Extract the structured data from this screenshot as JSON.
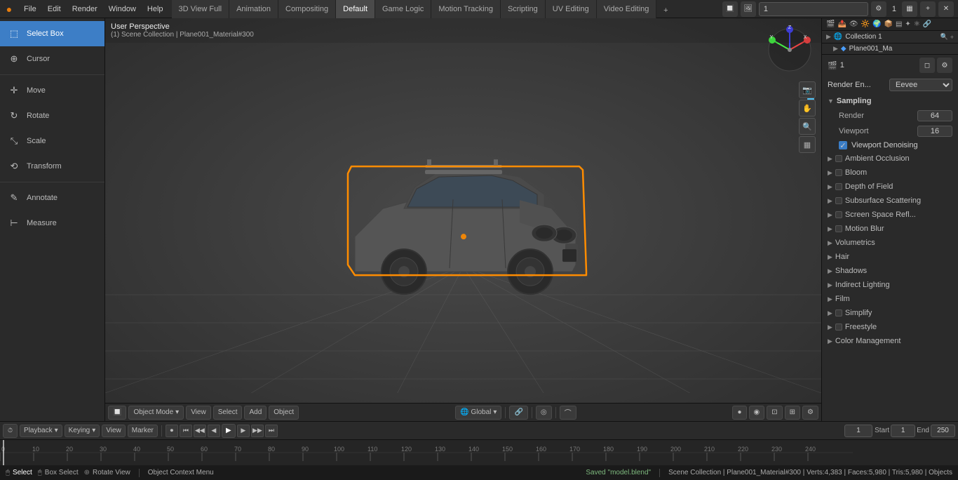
{
  "app": {
    "title": "Blender"
  },
  "menu": {
    "items": [
      "File",
      "Edit",
      "Render",
      "Window",
      "Help"
    ]
  },
  "workspace_tabs": [
    {
      "label": "3D View Full",
      "active": false
    },
    {
      "label": "Animation",
      "active": false
    },
    {
      "label": "Compositing",
      "active": false
    },
    {
      "label": "Default",
      "active": true
    },
    {
      "label": "Game Logic",
      "active": false
    },
    {
      "label": "Motion Tracking",
      "active": false
    },
    {
      "label": "Scripting",
      "active": false
    },
    {
      "label": "UV Editing",
      "active": false
    },
    {
      "label": "Video Editing",
      "active": false
    }
  ],
  "viewport": {
    "perspective": "User Perspective",
    "breadcrumb": "(1) Scene Collection | Plane001_Material#300"
  },
  "tools": [
    {
      "id": "select-box",
      "label": "Select Box",
      "icon": "⬚",
      "active": true
    },
    {
      "id": "cursor",
      "label": "Cursor",
      "icon": "⊕",
      "active": false
    },
    {
      "id": "divider1",
      "type": "divider"
    },
    {
      "id": "move",
      "label": "Move",
      "icon": "✛",
      "active": false
    },
    {
      "id": "rotate",
      "label": "Rotate",
      "icon": "↻",
      "active": false
    },
    {
      "id": "scale",
      "label": "Scale",
      "icon": "⤡",
      "active": false
    },
    {
      "id": "transform",
      "label": "Transform",
      "icon": "⟲",
      "active": false
    },
    {
      "id": "divider2",
      "type": "divider"
    },
    {
      "id": "annotate",
      "label": "Annotate",
      "icon": "✎",
      "active": false
    },
    {
      "id": "measure",
      "label": "Measure",
      "icon": "⊢",
      "active": false
    }
  ],
  "right_panel": {
    "collection": "Collection 1",
    "object": "Plane001_Ma",
    "render_layer_num": "1",
    "render_engine_label": "Render En...",
    "render_engine_value": "Eevee",
    "sampling_label": "Sampling",
    "render_label": "Render",
    "render_value": "64",
    "viewport_label": "Viewport",
    "viewport_value": "16",
    "viewport_denoising": "Viewport Denoising",
    "sections": [
      {
        "label": "Ambient Occlusion",
        "checked": false
      },
      {
        "label": "Bloom",
        "checked": false
      },
      {
        "label": "Depth of Field",
        "checked": false
      },
      {
        "label": "Subsurface Scattering",
        "checked": false
      },
      {
        "label": "Screen Space Refl...",
        "checked": false
      },
      {
        "label": "Motion Blur",
        "checked": false
      },
      {
        "label": "Volumetrics",
        "checked": false
      },
      {
        "label": "Hair",
        "checked": false
      },
      {
        "label": "Shadows",
        "checked": false
      },
      {
        "label": "Indirect Lighting",
        "checked": false
      },
      {
        "label": "Film",
        "checked": false
      },
      {
        "label": "Simplify",
        "checked": false
      },
      {
        "label": "Freestyle",
        "checked": false
      },
      {
        "label": "Color Management",
        "checked": false
      }
    ]
  },
  "viewport_toolbar": {
    "mode_label": "Object Mode",
    "view": "View",
    "select": "Select",
    "add": "Add",
    "object": "Object",
    "transform_label": "Global",
    "snap_label": "Snap"
  },
  "timeline": {
    "playback_label": "Playback",
    "keying_label": "Keying",
    "view_label": "View",
    "marker_label": "Marker",
    "frame_current": "1",
    "start_label": "Start",
    "start_value": "1",
    "end_label": "End",
    "end_value": "250"
  },
  "ruler": {
    "ticks": [
      0,
      10,
      20,
      30,
      40,
      50,
      60,
      70,
      80,
      90,
      100,
      110,
      120,
      130,
      140,
      150,
      160,
      170,
      180,
      190,
      200,
      210,
      220,
      230,
      240
    ]
  },
  "status_bar": {
    "select": "Select",
    "box_select": "Box Select",
    "rotate_view": "Rotate View",
    "context_menu": "Object Context Menu",
    "saved_msg": "Saved \"model.blend\"",
    "scene_info": "Scene Collection | Plane001_Material#300 | Verts:4,383 | Faces:5,980 | Tris:5,980 | Objects"
  }
}
